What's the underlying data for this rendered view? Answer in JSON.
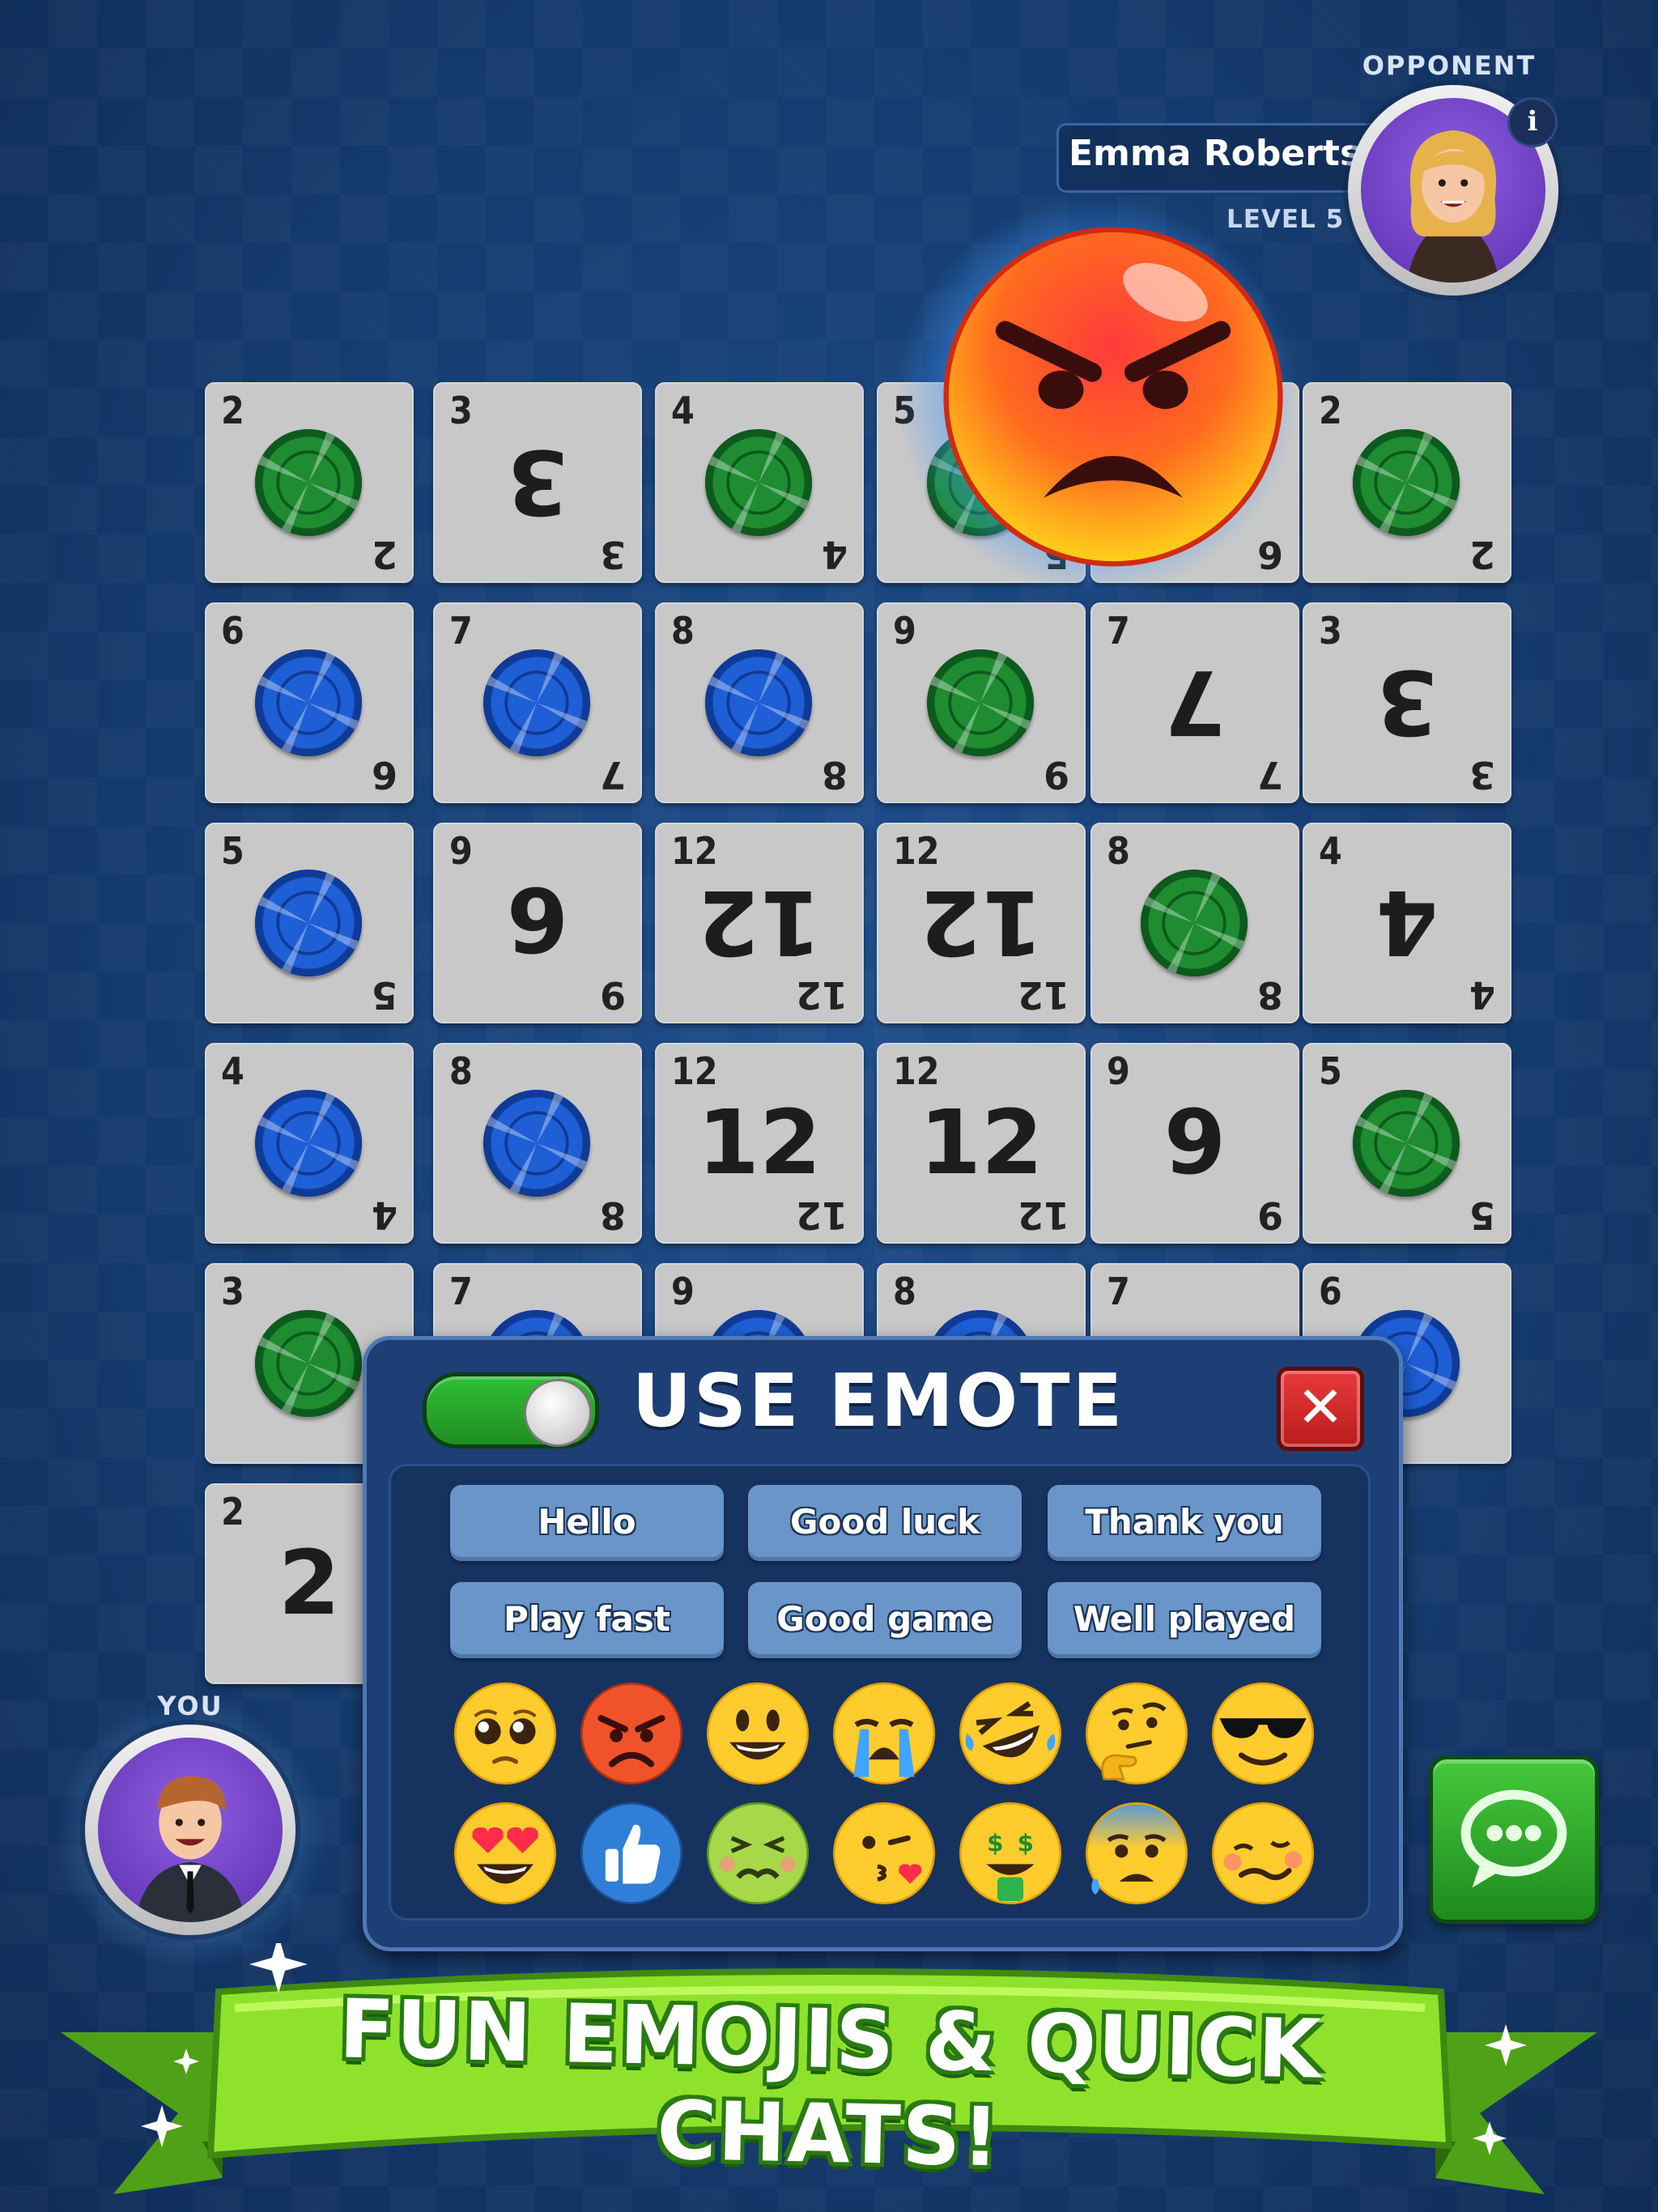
{
  "opponent": {
    "label": "OPPONENT",
    "name": "Emma Roberts",
    "level": "LEVEL 5",
    "info_icon": "i"
  },
  "you": {
    "label": "YOU"
  },
  "board": {
    "rows": [
      [
        {
          "tl": "2",
          "br": "2",
          "chip": "green"
        },
        {
          "tl": "3",
          "br": "3",
          "big": "3",
          "flip": true
        },
        {
          "tl": "4",
          "br": "4",
          "chip": "green"
        },
        {
          "tl": "5",
          "br": "5",
          "chip": "green"
        },
        {
          "tl": "",
          "br": "6",
          "chip": ""
        },
        {
          "tl": "2",
          "br": "2",
          "chip": "green"
        }
      ],
      [
        {
          "tl": "6",
          "br": "6",
          "chip": "blue"
        },
        {
          "tl": "7",
          "br": "7",
          "chip": "blue"
        },
        {
          "tl": "8",
          "br": "8",
          "chip": "blue"
        },
        {
          "tl": "9",
          "br": "9",
          "chip": "green"
        },
        {
          "tl": "7",
          "br": "7",
          "big": "7",
          "flip": true
        },
        {
          "tl": "3",
          "br": "3",
          "big": "3",
          "flip": true
        }
      ],
      [
        {
          "tl": "5",
          "br": "5",
          "chip": "blue"
        },
        {
          "tl": "9",
          "br": "9",
          "big": "9",
          "flip": false
        },
        {
          "tl": "12",
          "br": "12",
          "big": "12",
          "flip": true
        },
        {
          "tl": "12",
          "br": "12",
          "big": "12",
          "flip": true
        },
        {
          "tl": "8",
          "br": "8",
          "chip": "green"
        },
        {
          "tl": "4",
          "br": "4",
          "big": "4",
          "flip": true
        }
      ],
      [
        {
          "tl": "4",
          "br": "4",
          "chip": "blue"
        },
        {
          "tl": "8",
          "br": "8",
          "chip": "blue"
        },
        {
          "tl": "12",
          "br": "12",
          "big": "12",
          "flip": false
        },
        {
          "tl": "12",
          "br": "12",
          "big": "12",
          "flip": false
        },
        {
          "tl": "9",
          "br": "9",
          "big": "9",
          "flip": false
        },
        {
          "tl": "5",
          "br": "5",
          "chip": "green"
        }
      ],
      [
        {
          "tl": "3",
          "br": "",
          "chip": "green"
        },
        {
          "tl": "7",
          "br": "",
          "chip": "blue"
        },
        {
          "tl": "9",
          "br": "",
          "chip": "blue"
        },
        {
          "tl": "8",
          "br": "",
          "chip": "blue"
        },
        {
          "tl": "7",
          "br": "",
          "chip": ""
        },
        {
          "tl": "6",
          "br": "",
          "chip": "blue"
        }
      ],
      [
        {
          "tl": "2",
          "br": "",
          "big": "2",
          "flip": false
        }
      ]
    ]
  },
  "emote_panel": {
    "title": "USE EMOTE",
    "toggle_on": true,
    "close_icon": "✕",
    "quick_chats": [
      "Hello",
      "Good luck",
      "Thank you",
      "Play fast",
      "Good game",
      "Well played"
    ],
    "emojis": [
      "pleading-face",
      "angry-face",
      "smiling-face",
      "crying-face",
      "rofl-face",
      "thinking-face",
      "sunglasses-face",
      "heart-eyes-face",
      "thumbs-up",
      "nauseated-face",
      "kissing-heart-face",
      "money-mouth-face",
      "anxious-sweat-face",
      "woozy-face"
    ]
  },
  "chat_button_icon": "speech-bubble-icon",
  "banner": {
    "text": "FUN EMOJIS & QUICK CHATS!"
  },
  "colors": {
    "background": "#173f75",
    "card": "#c8c8c8",
    "chip_green": "#1f8c32",
    "chip_blue": "#1f5fd6",
    "banner_green": "#7ed321"
  }
}
